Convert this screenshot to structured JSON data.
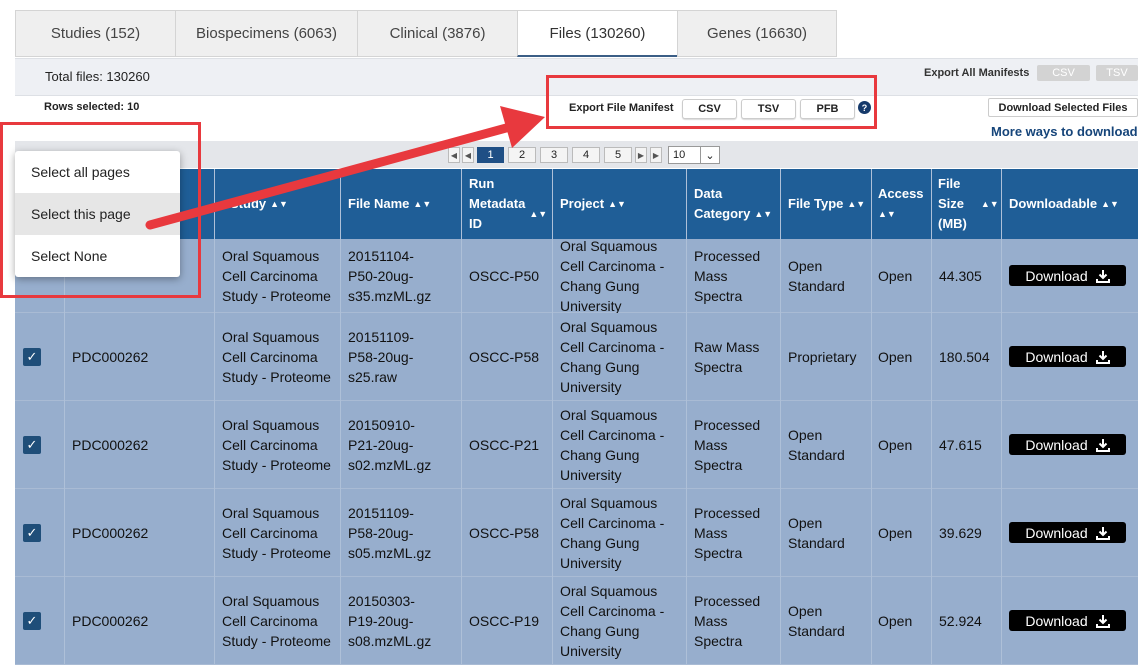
{
  "tabs": [
    "Studies (152)",
    "Biospecimens (6063)",
    "Clinical (3876)",
    "Files (130260)",
    "Genes (16630)"
  ],
  "total_files": "Total files: 130260",
  "export_all": {
    "label": "Export All Manifests",
    "csv": "CSV",
    "tsv": "TSV"
  },
  "rows_selected": "Rows selected: 10",
  "export_file_manifest": {
    "label": "Export File Manifest",
    "csv": "CSV",
    "tsv": "TSV",
    "pfb": "PFB",
    "help": "?"
  },
  "download_selected": "Download Selected Files",
  "more_ways": "More ways to download",
  "pagination": {
    "pages": [
      "1",
      "2",
      "3",
      "4",
      "5"
    ],
    "current": "1",
    "page_size": "10"
  },
  "dropdown": {
    "items": [
      "Select all pages",
      "Select this page",
      "Select None"
    ],
    "highlighted": "Select this page"
  },
  "columns": [
    "Study",
    "File Name",
    "Run Metadata ID",
    "Project",
    "Data Category",
    "File Type",
    "Access",
    "File Size (MB)",
    "Downloadable"
  ],
  "column_lines": {
    "study": [
      "Study"
    ],
    "file_name": [
      "File Name"
    ],
    "run_metadata": [
      "Run",
      "Metadata",
      "ID"
    ],
    "project": [
      "Project"
    ],
    "data_category": [
      "Data",
      "Category"
    ],
    "file_type": [
      "File Type"
    ],
    "access": [
      "Access"
    ],
    "file_size": [
      "File",
      "Size",
      "(MB)"
    ],
    "downloadable": [
      "Downloadable"
    ]
  },
  "download_label": "Download",
  "rows": [
    {
      "checked": true,
      "study_id": "",
      "study": [
        "Oral Squamous",
        "Cell Carcinoma",
        "Study - Proteome"
      ],
      "file_name": [
        "20151104-",
        "P50-20ug-",
        "s35.mzML.gz"
      ],
      "run_metadata": "OSCC-P50",
      "project": [
        "Oral Squamous",
        "Cell Carcinoma -",
        "Chang Gung",
        "University"
      ],
      "data_category": [
        "Processed",
        "Mass",
        "Spectra"
      ],
      "file_type": [
        "Open",
        "Standard"
      ],
      "access": "Open",
      "size": "44.305"
    },
    {
      "checked": true,
      "study_id": "PDC000262",
      "study": [
        "Oral Squamous",
        "Cell Carcinoma",
        "Study - Proteome"
      ],
      "file_name": [
        "20151109-",
        "P58-20ug-",
        "s25.raw"
      ],
      "run_metadata": "OSCC-P58",
      "project": [
        "Oral Squamous",
        "Cell Carcinoma -",
        "Chang Gung",
        "University"
      ],
      "data_category": [
        "Raw Mass",
        "Spectra"
      ],
      "file_type": [
        "Proprietary"
      ],
      "access": "Open",
      "size": "180.504"
    },
    {
      "checked": true,
      "study_id": "PDC000262",
      "study": [
        "Oral Squamous",
        "Cell Carcinoma",
        "Study - Proteome"
      ],
      "file_name": [
        "20150910-",
        "P21-20ug-",
        "s02.mzML.gz"
      ],
      "run_metadata": "OSCC-P21",
      "project": [
        "Oral Squamous",
        "Cell Carcinoma -",
        "Chang Gung",
        "University"
      ],
      "data_category": [
        "Processed",
        "Mass",
        "Spectra"
      ],
      "file_type": [
        "Open",
        "Standard"
      ],
      "access": "Open",
      "size": "47.615"
    },
    {
      "checked": true,
      "study_id": "PDC000262",
      "study": [
        "Oral Squamous",
        "Cell Carcinoma",
        "Study - Proteome"
      ],
      "file_name": [
        "20151109-",
        "P58-20ug-",
        "s05.mzML.gz"
      ],
      "run_metadata": "OSCC-P58",
      "project": [
        "Oral Squamous",
        "Cell Carcinoma -",
        "Chang Gung",
        "University"
      ],
      "data_category": [
        "Processed",
        "Mass",
        "Spectra"
      ],
      "file_type": [
        "Open",
        "Standard"
      ],
      "access": "Open",
      "size": "39.629"
    },
    {
      "checked": true,
      "study_id": "PDC000262",
      "study": [
        "Oral Squamous",
        "Cell Carcinoma",
        "Study - Proteome"
      ],
      "file_name": [
        "20150303-",
        "P19-20ug-",
        "s08.mzML.gz"
      ],
      "run_metadata": "OSCC-P19",
      "project": [
        "Oral Squamous",
        "Cell Carcinoma -",
        "Chang Gung",
        "University"
      ],
      "data_category": [
        "Processed",
        "Mass",
        "Spectra"
      ],
      "file_type": [
        "Open",
        "Standard"
      ],
      "access": "Open",
      "size": "52.924"
    }
  ],
  "colors": {
    "header_bg": "#1f5e97",
    "row_bg": "#97aecd",
    "checkbox": "#1f4e79",
    "annotation_red": "#e8393e",
    "link": "#16457a"
  }
}
